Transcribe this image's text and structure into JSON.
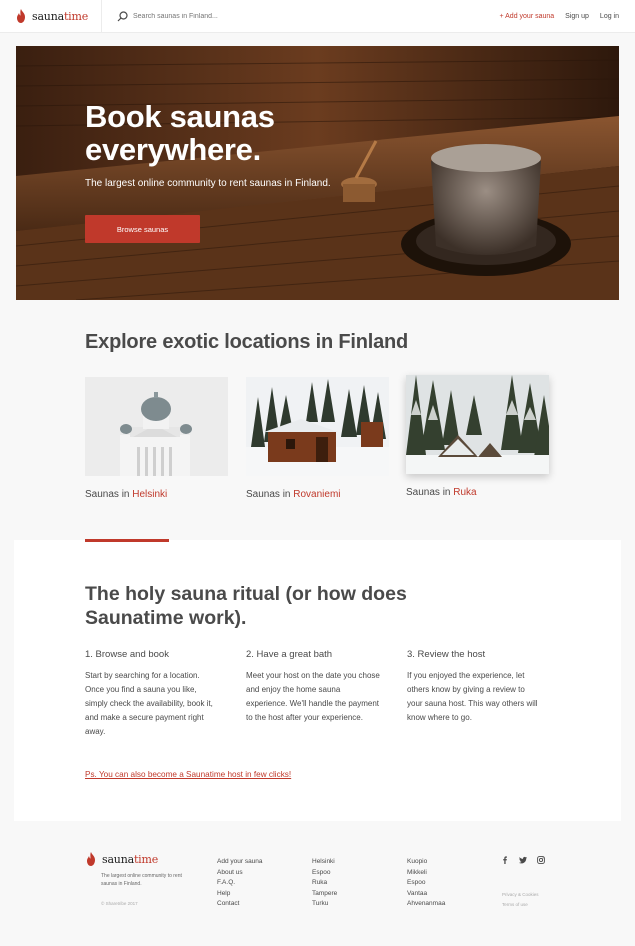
{
  "header": {
    "logo_word_main": "sauna",
    "logo_word_accent": "time",
    "search_placeholder": "Search saunas in Finland...",
    "add_sauna": "+ Add your sauna",
    "signup": "Sign up",
    "login": "Log in"
  },
  "hero": {
    "title": "Book saunas everywhere.",
    "subtitle": "The largest online community to rent saunas in Finland.",
    "button": "Browse saunas"
  },
  "explore": {
    "title": "Explore exotic locations in Finland",
    "locations": [
      {
        "prefix": "Saunas in ",
        "city": "Helsinki"
      },
      {
        "prefix": "Saunas in ",
        "city": "Rovaniemi"
      },
      {
        "prefix": "Saunas in ",
        "city": "Ruka"
      }
    ]
  },
  "ritual": {
    "title": "The holy sauna ritual (or how does Saunatime work).",
    "steps": [
      {
        "title": "1. Browse and book",
        "body": "Start by searching for a location. Once you find a sauna you like, simply check the availability, book it, and make a secure payment right away."
      },
      {
        "title": "2. Have a great bath",
        "body": "Meet your host on the date you chose and enjoy the home sauna experience. We'll handle the payment to the host after your experience."
      },
      {
        "title": "3. Review the host",
        "body": "If you enjoyed the experience, let others know by giving a review to your sauna host. This way others will know where to go."
      }
    ],
    "ps": "Ps. You can also become a Saunatime host in few clicks!"
  },
  "footer": {
    "tagline": "The largest online community to rent saunas in Finland.",
    "copyright": "© Sharetribe 2017",
    "col1": [
      "Add your sauna",
      "About us",
      "F.A.Q.",
      "Help",
      "Contact"
    ],
    "col2": [
      "Helsinki",
      "Espoo",
      "Ruka",
      "Tampere",
      "Turku"
    ],
    "col3": [
      "Kuopio",
      "Mikkeli",
      "Espoo",
      "Vantaa",
      "Ahvenanmaa"
    ],
    "social": [
      "facebook-icon",
      "twitter-icon",
      "instagram-icon"
    ],
    "privacy": "Privacy & Cookies",
    "terms": "Terms of use"
  },
  "colors": {
    "accent": "#c0392b",
    "text": "#4a4a4a",
    "background": "#f8f8f8"
  }
}
